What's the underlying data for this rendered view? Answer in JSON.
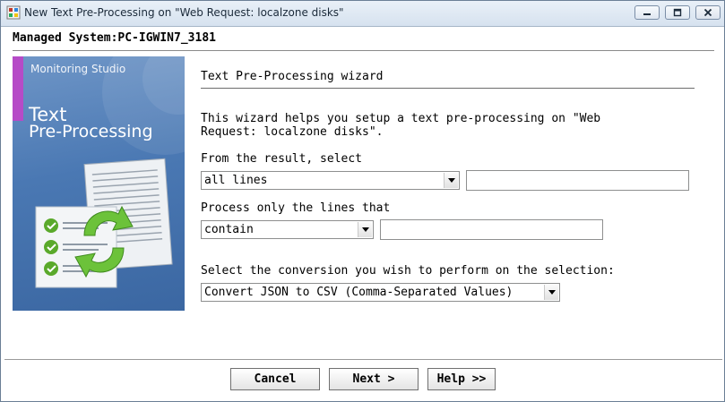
{
  "window": {
    "title": "New Text Pre-Processing on \"Web Request: localzone disks\"",
    "minimize_icon": "minimize-icon",
    "maximize_icon": "maximize-icon",
    "close_icon": "close-icon"
  },
  "managed_system": "Managed System:PC-IGWIN7_3181",
  "banner": {
    "brand": "Monitoring Studio",
    "title_line1": "Text",
    "title_line2": "Pre-Processing"
  },
  "wizard": {
    "heading": "Text Pre-Processing wizard",
    "intro": "This wizard helps you setup a text pre-processing on \"Web\nRequest: localzone disks\"."
  },
  "form": {
    "select_from_label": "From the result, select",
    "select_from_value": "all lines",
    "select_from_text": "",
    "process_label": "Process only the lines that",
    "process_value": "contain",
    "process_text": "",
    "conversion_label": "Select the conversion you wish to perform on the selection:",
    "conversion_value": "Convert JSON to CSV (Comma-Separated Values)"
  },
  "buttons": {
    "cancel": "Cancel",
    "next": "Next >",
    "help": "Help >>"
  },
  "colors": {
    "banner_blue": "#4a78b3",
    "banner_accent": "#b64bc7",
    "check_green": "#5aa92b"
  }
}
